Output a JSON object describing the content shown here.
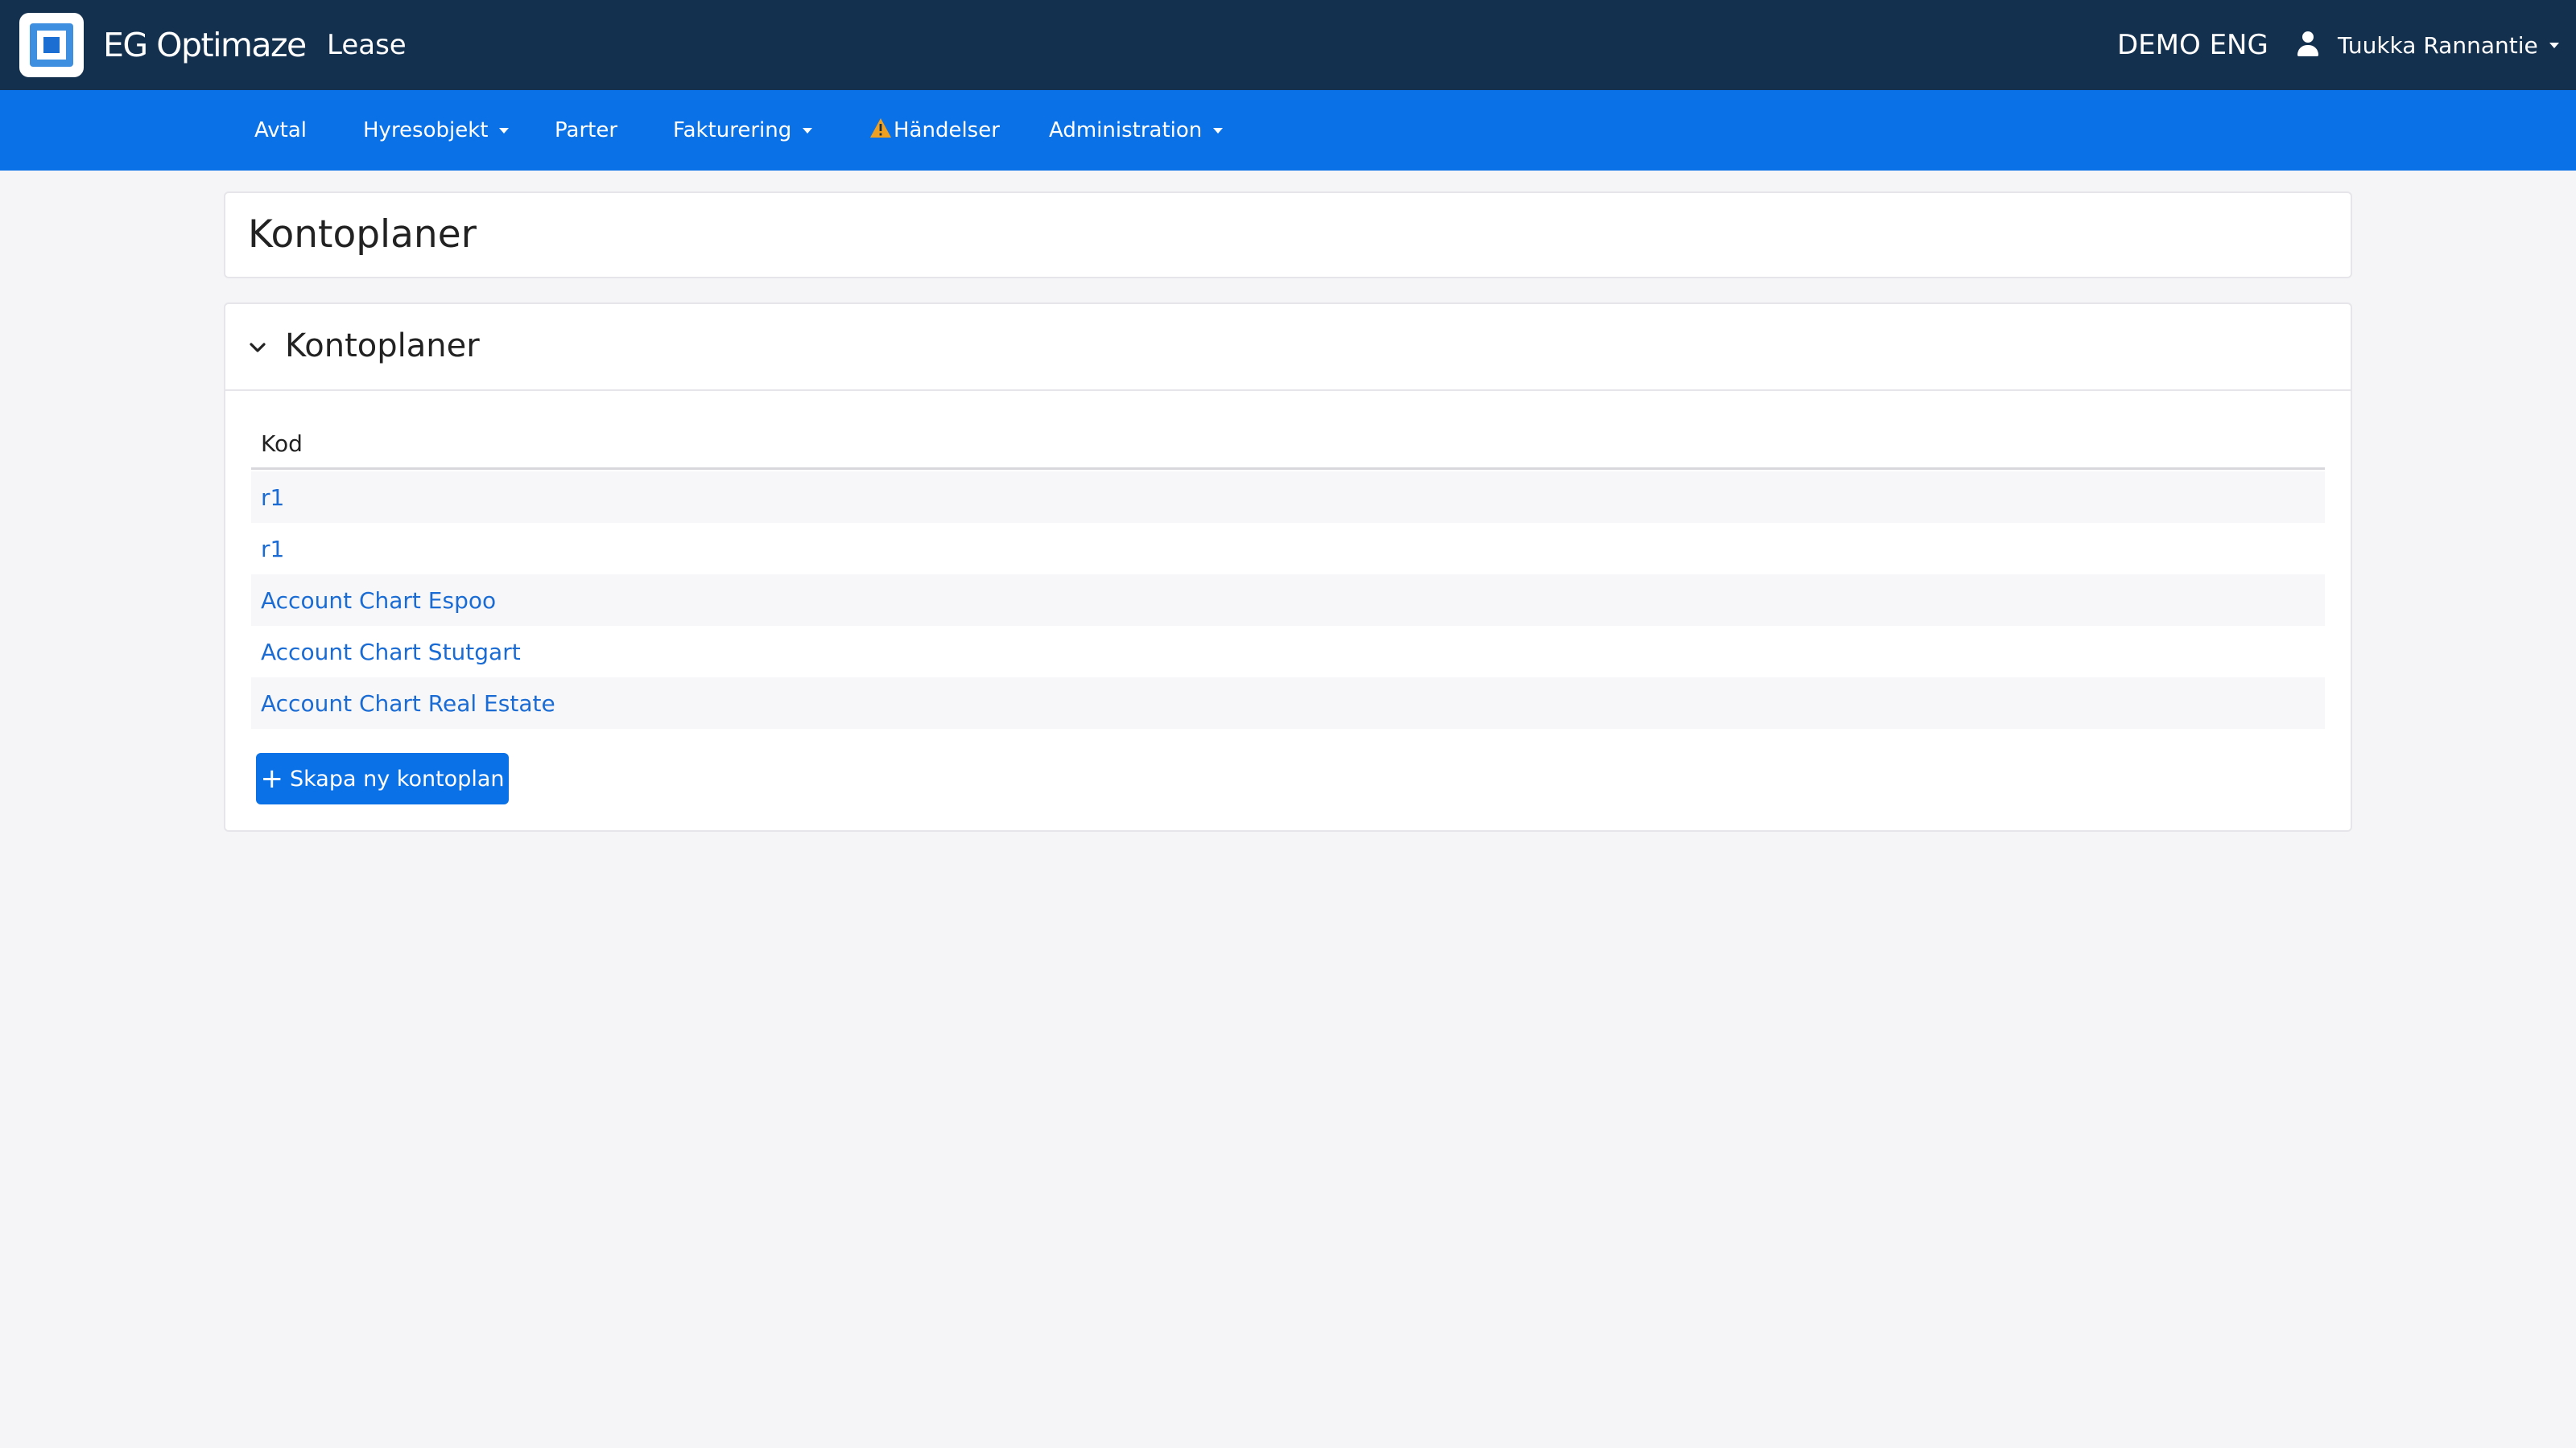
{
  "topbar": {
    "brand": "EG Optimaze",
    "module": "Lease",
    "organization": "DEMO ENG",
    "user": "Tuukka Rannantie",
    "colors": {
      "background": "#14304f",
      "logo_blue": "#3f8fe0"
    }
  },
  "nav": {
    "background": "#0b71e6",
    "items": [
      {
        "label": "Avtal",
        "dropdown": false
      },
      {
        "label": "Hyresobjekt",
        "dropdown": true
      },
      {
        "label": "Parter",
        "dropdown": false
      },
      {
        "label": "Fakturering",
        "dropdown": true
      },
      {
        "label": "Händelser",
        "dropdown": false,
        "icon": "warning-icon"
      },
      {
        "label": "Administration",
        "dropdown": true
      }
    ]
  },
  "page": {
    "title": "Kontoplaner"
  },
  "panel": {
    "title": "Kontoplaner",
    "column_header": "Kod",
    "rows": [
      {
        "label": "r1"
      },
      {
        "label": "r1"
      },
      {
        "label": "Account Chart Espoo"
      },
      {
        "label": "Account Chart Stutgart"
      },
      {
        "label": "Account Chart Real Estate"
      }
    ],
    "create_button": "Skapa ny kontoplan",
    "link_color": "#1a6cd4"
  }
}
